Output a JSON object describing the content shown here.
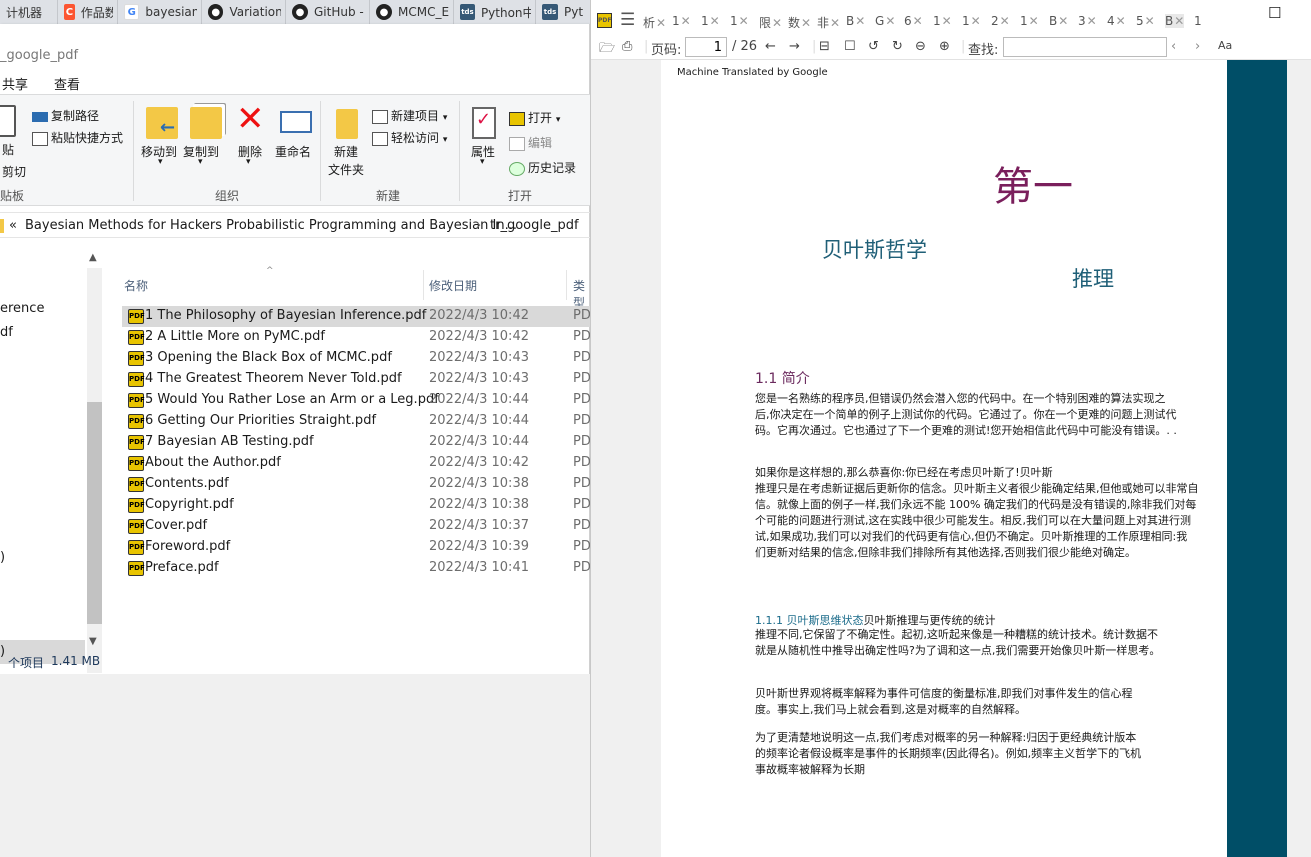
{
  "browser_tabs": [
    {
      "icon": "page-icon",
      "label": "计机器"
    },
    {
      "icon": "csdn-icon",
      "label": "作品数据"
    },
    {
      "icon": "google-icon",
      "label": "bayesian"
    },
    {
      "icon": "github-icon",
      "label": "Variation"
    },
    {
      "icon": "github-icon",
      "label": "GitHub -"
    },
    {
      "icon": "github-icon",
      "label": "MCMC_E"
    },
    {
      "icon": "tds-icon",
      "label": "Python中"
    },
    {
      "icon": "tds-icon",
      "label": "Pyt"
    }
  ],
  "explorer": {
    "title": "_google_pdf",
    "menus": {
      "share": "共享",
      "view": "查看"
    },
    "ribbon": {
      "paste_label": "贴",
      "cut_label": "剪切",
      "copy_path": "复制路径",
      "paste_shortcut": "粘贴快捷方式",
      "clipboard_group": "贴板",
      "move_to": "移动到",
      "copy_to": "复制到",
      "delete": "删除",
      "rename": "重命名",
      "organize_group": "组织",
      "new_folder_line1": "新建",
      "new_folder_line2": "文件夹",
      "new_item": "新建项目",
      "easy_access": "轻松访问",
      "new_group": "新建",
      "properties": "属性",
      "open": "打开",
      "edit": "编辑",
      "history": "历史记录",
      "open_group": "打开"
    },
    "address": {
      "chevrons": "«",
      "parent": "Bayesian Methods for Hackers Probabilistic Programming and Bayesian In...",
      "separator": "›",
      "current": "tr_google_pdf"
    },
    "nav_items": [
      "erence",
      "df",
      ")",
      ")"
    ],
    "columns": {
      "name": "名称",
      "date": "修改日期",
      "type": "类型"
    },
    "files": [
      {
        "name": "1 The Philosophy of Bayesian Inference.pdf",
        "date": "2022/4/3 10:42",
        "type": "PD"
      },
      {
        "name": "2 A Little More on PyMC.pdf",
        "date": "2022/4/3 10:42",
        "type": "PD"
      },
      {
        "name": "3 Opening the Black Box of MCMC.pdf",
        "date": "2022/4/3 10:43",
        "type": "PD"
      },
      {
        "name": "4 The Greatest Theorem Never Told.pdf",
        "date": "2022/4/3 10:43",
        "type": "PD"
      },
      {
        "name": "5 Would You Rather Lose an Arm or a Leg.pdf",
        "date": "2022/4/3 10:44",
        "type": "PD"
      },
      {
        "name": "6 Getting Our Priorities Straight.pdf",
        "date": "2022/4/3 10:44",
        "type": "PD"
      },
      {
        "name": "7 Bayesian AB Testing.pdf",
        "date": "2022/4/3 10:44",
        "type": "PD"
      },
      {
        "name": "About the Author.pdf",
        "date": "2022/4/3 10:42",
        "type": "PD"
      },
      {
        "name": "Contents.pdf",
        "date": "2022/4/3 10:38",
        "type": "PD"
      },
      {
        "name": "Copyright.pdf",
        "date": "2022/4/3 10:38",
        "type": "PD"
      },
      {
        "name": "Cover.pdf",
        "date": "2022/4/3 10:37",
        "type": "PD"
      },
      {
        "name": "Foreword.pdf",
        "date": "2022/4/3 10:39",
        "type": "PD"
      },
      {
        "name": "Preface.pdf",
        "date": "2022/4/3 10:41",
        "type": "PD"
      }
    ],
    "status": {
      "items": "个项目",
      "size": "1.41 MB"
    }
  },
  "pdf": {
    "tabs": [
      "析",
      "1",
      "1",
      "1",
      "限",
      "数",
      "非",
      "B",
      "G",
      "6",
      "1",
      "1",
      "2",
      "1",
      "B",
      "3",
      "4",
      "5",
      "B",
      "1"
    ],
    "toolbar": {
      "page_label": "页码:",
      "page_value": "1",
      "page_total": "/ 26",
      "find_label": "查找:",
      "font_label": "Aa"
    },
    "page": {
      "watermark": "Machine Translated by Google",
      "chapter": "第一",
      "title1": "贝叶斯哲学",
      "title2": "推理",
      "sec1": "1.1 简介",
      "para1": [
        "您是一名熟练的程序员,但错误仍然会潜入您的代码中。在一个特别困难的算法实现之",
        "后,你决定在一个简单的例子上测试你的代码。它通过了。你在一个更难的问题上测试代",
        "码。它再次通过。它也通过了下一个更难的测试!您开始相信此代码中可能没有错误。. ."
      ],
      "para2": [
        "    如果你是这样想的,那么恭喜你:你已经在考虑贝叶斯了!贝叶斯",
        "推理只是在考虑新证据后更新你的信念。贝叶斯主义者很少能确定结果,但他或她可以非常自",
        "信。就像上面的例子一样,我们永远不能 100% 确定我们的代码是没有错误的,除非我们对每",
        "个可能的问题进行测试,这在实践中很少可能发生。相反,我们可以在大量问题上对其进行测",
        "试,如果成功,我们可以对我们的代码更有信心,但仍不确定。贝叶斯推理的工作原理相同:我",
        "们更新对结果的信念,但除非我们排除所有其他选择,否则我们很少能绝对确定。"
      ],
      "sub_link": "1.1.1 贝叶斯思维状态",
      "sub_rest": "贝叶斯推理与更传统的统计",
      "para3": [
        "推理不同,它保留了不确定性。起初,这听起来像是一种糟糕的统计技术。统计数据不",
        "就是从随机性中推导出确定性吗?为了调和这一点,我们需要开始像贝叶斯一样思考。"
      ],
      "para4": [
        "    贝叶斯世界观将概率解释为事件可信度的衡量标准,即我们对事件发生的信心程",
        "度。事实上,我们马上就会看到,这是对概率的自然解释。"
      ],
      "para5": [
        "    为了更清楚地说明这一点,我们考虑对概率的另一种解释:归因于更经典统计版本",
        "的频率论者假设概率是事件的长期频率(因此得名)。例如,频率主义哲学下的飞机",
        "事故概率被解释为长期"
      ]
    }
  },
  "colors": {
    "chapter": "#7a1f5c",
    "title": "#1f5f77",
    "band": "#004e67",
    "section": "#6b2a5e",
    "subsection": "#1a6b8a"
  }
}
